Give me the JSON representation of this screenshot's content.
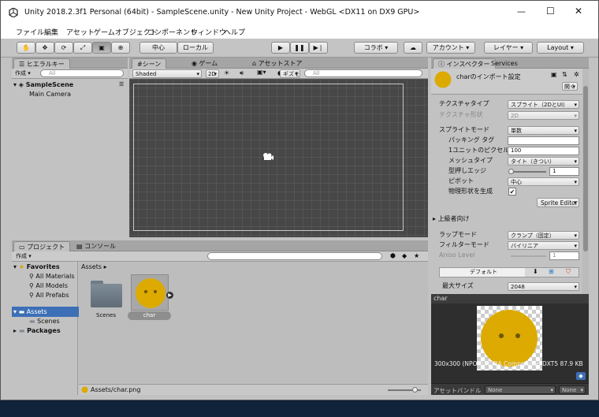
{
  "window": {
    "title": "Unity 2018.2.3f1 Personal (64bit) - SampleScene.unity - New Unity Project - WebGL <DX11 on DX9 GPU>",
    "controls": {
      "minimize": "—",
      "maximize": "☐",
      "close": "✕"
    }
  },
  "menu": [
    "ファイル",
    "編集",
    "アセット",
    "ゲームオブジェクト",
    "コンポーネント",
    "ウィンドウ",
    "ヘルプ"
  ],
  "toolbar": {
    "pivot": "中心",
    "space": "ローカル",
    "collab": "コラボ",
    "account": "アカウント",
    "layers": "レイヤー",
    "layout": "Layout"
  },
  "hierarchy": {
    "tab": "ヒエラルキー",
    "create": "作成",
    "search_placeholder": "All",
    "scene": "SampleScene",
    "items": [
      "Main Camera"
    ]
  },
  "scene_view": {
    "tabs": [
      "シーン",
      "ゲーム",
      "アセットストア"
    ],
    "shading": "Shaded",
    "mode_2d": "2D",
    "gizmos": "ギズモ",
    "search_placeholder": "All"
  },
  "project": {
    "tabs": [
      "プロジェクト",
      "コンソール"
    ],
    "create": "作成",
    "tree": {
      "favorites": "Favorites",
      "fav_items": [
        "All Materials",
        "All Models",
        "All Prefabs"
      ],
      "assets": "Assets",
      "asset_items": [
        "Scenes"
      ],
      "packages": "Packages"
    },
    "breadcrumb": "Assets",
    "assets": [
      "Scenes",
      "char"
    ],
    "status_path": "Assets/char.png"
  },
  "inspector": {
    "tabs": [
      "インスペクター",
      "Services"
    ],
    "title": "charのインポート設定",
    "open_button": "開く",
    "fields": {
      "texture_type_label": "テクスチャタイプ",
      "texture_type_value": "スプライト（2DとUI）",
      "texture_shape_label": "テクスチャ形状",
      "texture_shape_value": "2D",
      "sprite_mode_label": "スプライトモード",
      "sprite_mode_value": "単数",
      "packing_tag_label": "パッキング タグ",
      "packing_tag_value": "",
      "ppu_label": "1ユニットのピクセル数",
      "ppu_value": "100",
      "mesh_type_label": "メッシュタイプ",
      "mesh_type_value": "タイト（きつい）",
      "extrude_label": "型押しエッジ",
      "extrude_value": "1",
      "pivot_label": "ピボット",
      "pivot_value": "中心",
      "physics_label": "物理形状を生成",
      "sprite_editor": "Sprite Editor",
      "advanced_label": "上級者向け",
      "wrap_label": "ラップモード",
      "wrap_value": "クランプ（固定）",
      "filter_label": "フィルターモード",
      "filter_value": "バイリニア",
      "aniso_label": "Aniso Level",
      "aniso_value": "1",
      "platform_default": "デフォルト",
      "max_size_label": "最大サイズ",
      "max_size_value": "2048"
    },
    "preview": {
      "title": "char",
      "info": "300x300 (NPOT)  RGBA Compressed DXT5   87.9 KB",
      "bundle_label": "アセットバンドル",
      "bundle_value": "None",
      "variant_value": "None"
    }
  },
  "colors": {
    "char_yellow": "#dcaa00",
    "selection": "#3d6fb6"
  }
}
